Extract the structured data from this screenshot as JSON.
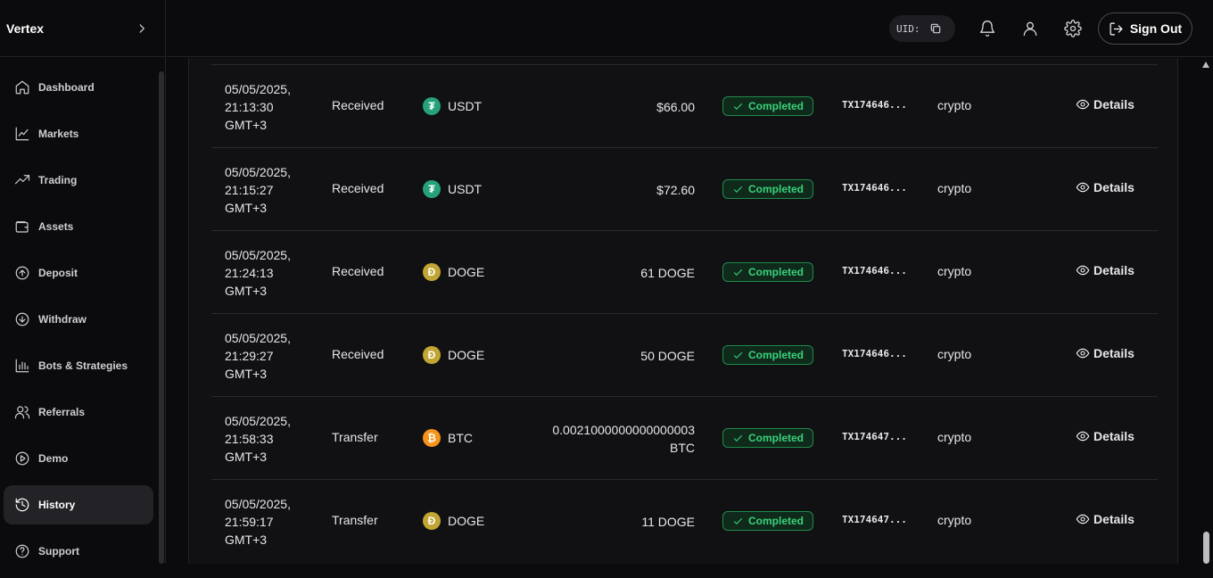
{
  "app": {
    "brand": "Vertex"
  },
  "sidebar": {
    "items": [
      {
        "label": "Dashboard",
        "icon": "home-icon"
      },
      {
        "label": "Markets",
        "icon": "line-chart-icon"
      },
      {
        "label": "Trading",
        "icon": "trending-up-icon"
      },
      {
        "label": "Assets",
        "icon": "wallet-icon"
      },
      {
        "label": "Deposit",
        "icon": "arrow-up-circle-icon"
      },
      {
        "label": "Withdraw",
        "icon": "arrow-down-circle-icon"
      },
      {
        "label": "Bots & Strategies",
        "icon": "bar-chart-icon"
      },
      {
        "label": "Referrals",
        "icon": "users-icon"
      },
      {
        "label": "Demo",
        "icon": "play-circle-icon"
      },
      {
        "label": "History",
        "icon": "history-icon",
        "active": true
      },
      {
        "label": "Support",
        "icon": "help-circle-icon"
      }
    ]
  },
  "header": {
    "uid_label": "UID:",
    "sign_out": "Sign Out"
  },
  "colors": {
    "completed": "#3ad17a",
    "usdt": "#26a17b",
    "doge": "#c2a633",
    "btc": "#f7931a"
  },
  "transactions": [
    {
      "date_line1": "05/05/2025,",
      "date_line2": "21:13:30",
      "date_line3": "GMT+3",
      "type": "Received",
      "asset": "USDT",
      "coin_glyph": "₮",
      "amount": "$66.00",
      "amount_line2": "",
      "status": "Completed",
      "txid": "TX174646...",
      "method": "crypto",
      "action": "Details"
    },
    {
      "date_line1": "05/05/2025,",
      "date_line2": "21:15:27",
      "date_line3": "GMT+3",
      "type": "Received",
      "asset": "USDT",
      "coin_glyph": "₮",
      "amount": "$72.60",
      "amount_line2": "",
      "status": "Completed",
      "txid": "TX174646...",
      "method": "crypto",
      "action": "Details"
    },
    {
      "date_line1": "05/05/2025,",
      "date_line2": "21:24:13",
      "date_line3": "GMT+3",
      "type": "Received",
      "asset": "DOGE",
      "coin_glyph": "Ð",
      "amount": "61 DOGE",
      "amount_line2": "",
      "status": "Completed",
      "txid": "TX174646...",
      "method": "crypto",
      "action": "Details"
    },
    {
      "date_line1": "05/05/2025,",
      "date_line2": "21:29:27",
      "date_line3": "GMT+3",
      "type": "Received",
      "asset": "DOGE",
      "coin_glyph": "Ð",
      "amount": "50 DOGE",
      "amount_line2": "",
      "status": "Completed",
      "txid": "TX174646...",
      "method": "crypto",
      "action": "Details"
    },
    {
      "date_line1": "05/05/2025,",
      "date_line2": "21:58:33",
      "date_line3": "GMT+3",
      "type": "Transfer",
      "asset": "BTC",
      "coin_glyph": "₿",
      "amount": "0.0021000000000000003",
      "amount_line2": "BTC",
      "status": "Completed",
      "txid": "TX174647...",
      "method": "crypto",
      "action": "Details"
    },
    {
      "date_line1": "05/05/2025,",
      "date_line2": "21:59:17",
      "date_line3": "GMT+3",
      "type": "Transfer",
      "asset": "DOGE",
      "coin_glyph": "Ð",
      "amount": "11 DOGE",
      "amount_line2": "",
      "status": "Completed",
      "txid": "TX174647...",
      "method": "crypto",
      "action": "Details"
    }
  ]
}
